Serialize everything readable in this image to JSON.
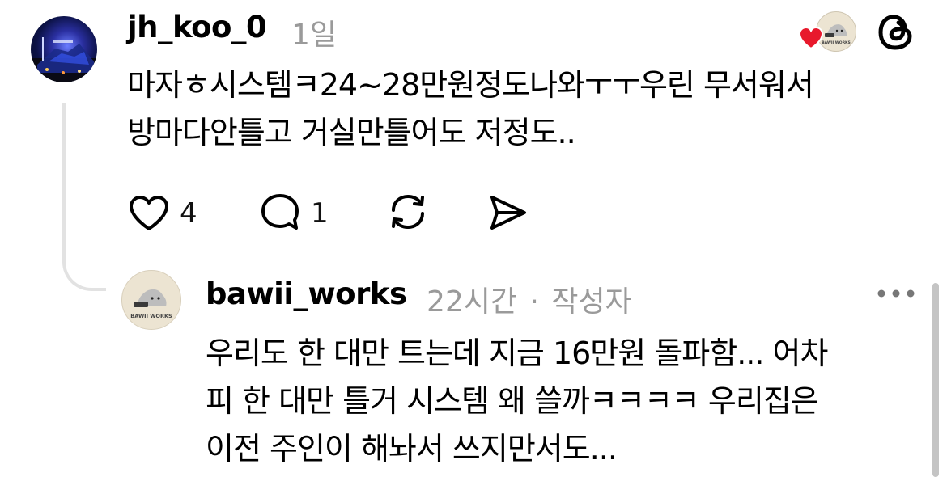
{
  "post": {
    "username": "jh_koo_0",
    "time": "1일",
    "text_line1": "마자ㅎ시스템ㅋ24~28만원정도나와ㅜㅜ우린 무서워서",
    "text_line2": "방마다안틀고 거실만틀어도 저정도..",
    "like_count": "4",
    "reply_count": "1",
    "liked_badge_icon": "heart-icon",
    "app_icon": "threads-logo-icon"
  },
  "reply": {
    "username": "bawii_works",
    "time": "22시간",
    "separator": "·",
    "author_tag": "작성자",
    "avatar_text": "BAWII WORKS",
    "text_line1": "우리도 한 대만 트는데 지금 16만원 돌파함... 어차",
    "text_line2": "피 한 대만 틀거 시스템 왜 쓸까ㅋㅋㅋㅋ 우리집은",
    "text_line3": "이전 주인이 해놔서 쓰지만서도..."
  },
  "colors": {
    "heart": "#e8192c",
    "muted": "#9a9a9a",
    "thread_line": "#e2e2e2",
    "avatar_badge_bg": "#ece4d2"
  }
}
